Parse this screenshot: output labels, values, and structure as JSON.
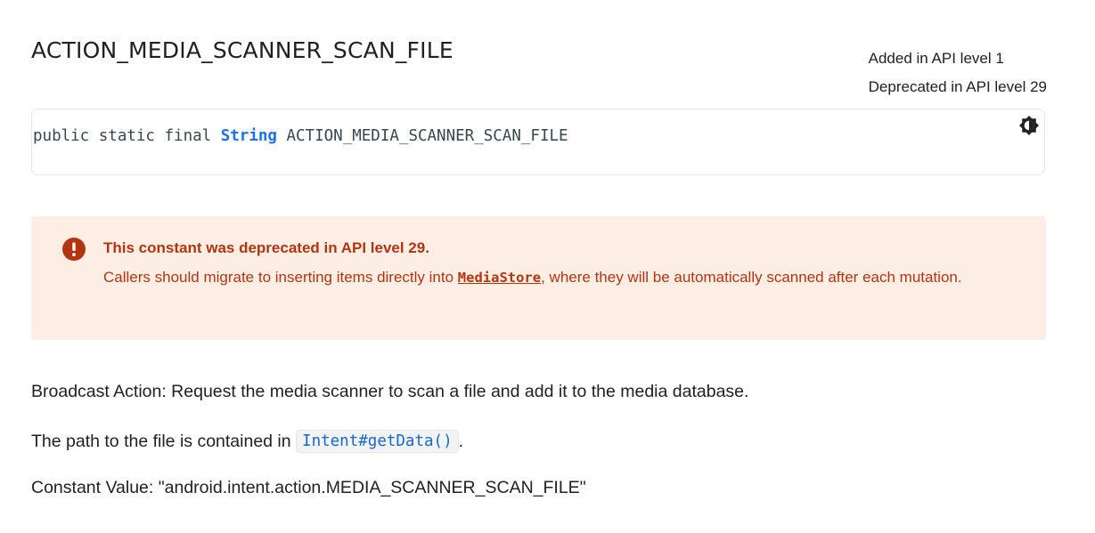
{
  "header": {
    "title": "ACTION_MEDIA_SCANNER_SCAN_FILE",
    "added": "Added in API level 1",
    "deprecated": "Deprecated in API level 29"
  },
  "signature": {
    "prefix": "public static final ",
    "type": "String",
    "name": " ACTION_MEDIA_SCANNER_SCAN_FILE",
    "toggle_icon": "theme-toggle-icon"
  },
  "deprecation": {
    "icon": "error-icon",
    "title": "This constant was deprecated in API level 29.",
    "body_before": "Callers should migrate to inserting items directly into ",
    "link": "MediaStore",
    "body_after": ", where they will be automatically scanned after each mutation.",
    "color": "#b3350f",
    "background": "#fdeee5"
  },
  "description": {
    "p1": "Broadcast Action: Request the media scanner to scan a file and add it to the media database.",
    "p2_before": "The path to the file is contained in ",
    "p2_link": "Intent#getData()",
    "p2_after": ".",
    "p3": "Constant Value: \"android.intent.action.MEDIA_SCANNER_SCAN_FILE\""
  }
}
